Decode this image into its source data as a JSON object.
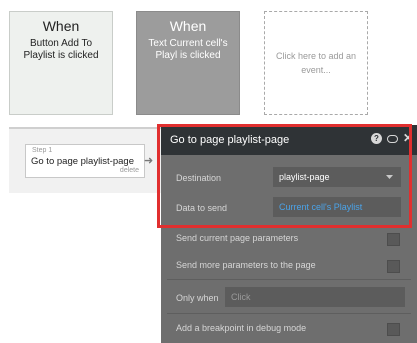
{
  "events": [
    {
      "when": "When",
      "desc": "Button Add To Playlist is clicked"
    },
    {
      "when": "When",
      "desc": "Text Current cell's Playl is clicked"
    },
    {
      "desc": "Click here to add an event..."
    }
  ],
  "step": {
    "num": "Step 1",
    "title": "Go to page playlist-page",
    "delete": "delete"
  },
  "panel": {
    "title": "Go to page playlist-page",
    "help_icon": "?",
    "close_icon": "✕",
    "destination_label": "Destination",
    "destination_value": "playlist-page",
    "data_label": "Data to send",
    "data_value": "Current cell's Playlist",
    "send_params_label": "Send current page parameters",
    "send_more_label": "Send more parameters to the page",
    "only_when_label": "Only when",
    "only_when_placeholder": "Click",
    "breakpoint_label": "Add a breakpoint in debug mode"
  }
}
